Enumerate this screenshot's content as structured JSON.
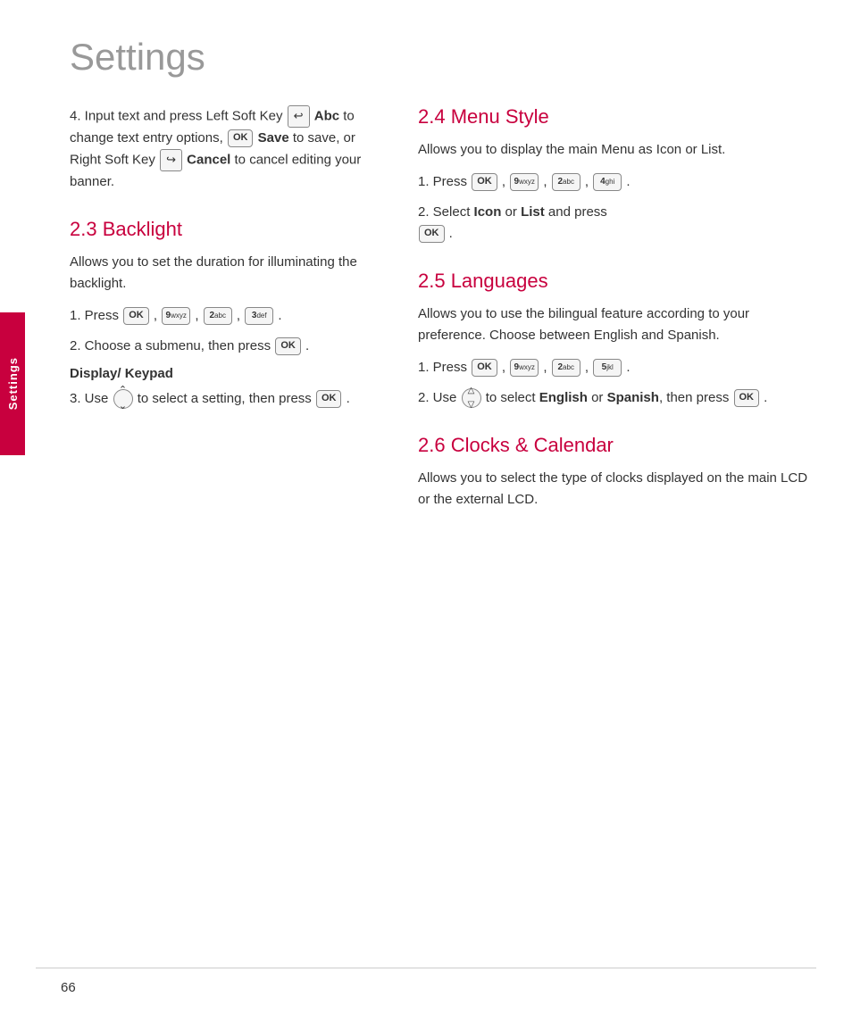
{
  "page": {
    "title": "Settings",
    "page_number": "66",
    "sidebar_label": "Settings"
  },
  "left_column": {
    "step4_intro": "4. Input text and press Left Soft Key",
    "step4_abc": "Abc",
    "step4_mid": "to change text entry options,",
    "step4_save": "Save",
    "step4_end": "to save, or Right Soft Key",
    "step4_cancel": "Cancel",
    "step4_finish": "to cancel editing your banner.",
    "section23_title": "2.3 Backlight",
    "section23_desc": "Allows you to set the duration for illuminating the backlight.",
    "step23_1": "1. Press",
    "step23_2": "2. Choose a submenu, then press",
    "display_keypad": "Display/ Keypad",
    "step23_3": "3. Use",
    "step23_3b": "to select a setting, then press"
  },
  "right_column": {
    "section24_title": "2.4 Menu Style",
    "section24_desc": "Allows you to display the main Menu as Icon or List.",
    "step24_1": "1. Press",
    "step24_2a": "2. Select",
    "step24_2_icon": "Icon",
    "step24_2_or": "or",
    "step24_2_list": "List",
    "step24_2b": "and press",
    "section25_title": "2.5 Languages",
    "section25_desc": "Allows you to use the bilingual feature according to your preference. Choose between English and Spanish.",
    "step25_1": "1. Press",
    "step25_2a": "2. Use",
    "step25_2b": "to select",
    "step25_2_english": "English",
    "step25_2_or": "or",
    "step25_2_spanish": "Spanish",
    "step25_2c": ", then press",
    "section26_title": "2.6 Clocks & Calendar",
    "section26_desc": "Allows you to select the type of clocks displayed on the main LCD or the external LCD."
  },
  "keys": {
    "ok": "OK",
    "9wxyz": "9wxyz",
    "2abc": "2abc",
    "4ghi": "4ghi",
    "3def": "3def",
    "5jkl": "5jkl"
  }
}
